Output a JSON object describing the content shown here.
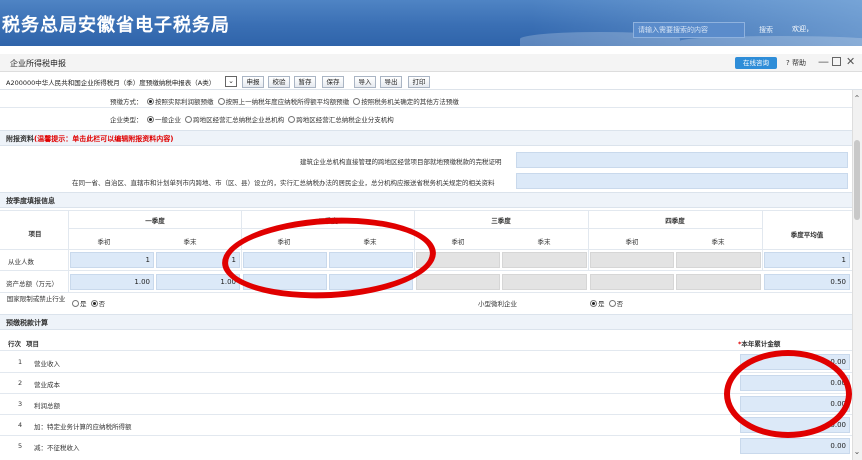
{
  "header": {
    "title": "税务总局安徽省电子税务局",
    "search_placeholder": "请输入需要搜索的内容",
    "search_label": "搜索",
    "welcome_text": "欢迎，"
  },
  "panel": {
    "title": "企业所得税申报",
    "online_help_label": "在线咨询",
    "help_label": "? 帮助",
    "minimize_label": "—",
    "close_label": "✕"
  },
  "toolbar": {
    "form_select_value": "A200000中华人民共和国企业所得税月（季）度预缴纳税申报表（A类）",
    "buttons": [
      "申报",
      "校验",
      "暂存",
      "保存",
      "导入",
      "导出",
      "打印"
    ]
  },
  "form": {
    "prepay_method_label": "预缴方式：",
    "prepay_options": [
      "按照实际利润额预缴",
      "按照上一纳税年度应纳税所得额平均额预缴",
      "按照税务机关确定的其他方法预缴"
    ],
    "enterprise_type_label": "企业类型：",
    "enterprise_options": [
      "一般企业",
      "跨地区经营汇总纳税企业总机构",
      "跨地区经营汇总纳税企业分支机构"
    ],
    "attach_title": "附报资料",
    "attach_hint": "(温馨提示：单击此栏可以编辑附报资料内容)",
    "attach_row1": "建筑企业总机构直接管理的跨地区经营项目部就地预缴税款的完税证明",
    "attach_row2": "在同一省、自治区、直辖市和计划单列市内跨地、市（区、县）设立的，实行汇总纳税办法的居民企业，总分机构应报送省税务机关规定的相关资料",
    "quarterly_title": "按季度填报信息",
    "item_header": "项目",
    "quarters": [
      "一季度",
      "二季度",
      "三季度",
      "四季度"
    ],
    "sub_headers": [
      "季初",
      "季末"
    ],
    "avg_header": "季度平均值",
    "employees_label": "从业人数",
    "employees_values": [
      "1",
      "1",
      "",
      "",
      "",
      "",
      "",
      ""
    ],
    "employees_avg": "1",
    "assets_label": "资产总额（万元）",
    "assets_values": [
      "1.00",
      "1.00",
      "",
      "",
      "",
      "",
      "",
      ""
    ],
    "assets_avg": "0.50",
    "restricted_label": "国家限制或禁止行业",
    "yes_label": "是",
    "no_label": "否",
    "small_label": "小型微利企业",
    "calc_title": "预缴税款计算",
    "row_no_header": "行次",
    "calc_item_header": "项目",
    "ytd_header": "本年累计金额",
    "ytd_star": "*",
    "rows": [
      {
        "no": "1",
        "label": "营业收入",
        "value": "0.00"
      },
      {
        "no": "2",
        "label": "营业成本",
        "value": "0.00"
      },
      {
        "no": "3",
        "label": "利润总额",
        "value": "0.00"
      },
      {
        "no": "4",
        "label": "加：特定业务计算的应纳税所得额",
        "value": "0.00"
      },
      {
        "no": "5",
        "label": "减：不征税收入",
        "value": "0.00"
      }
    ]
  },
  "colors": {
    "accent": "#2e8dd8",
    "banner": "#3a6fb4",
    "input_cell": "#dce9f8",
    "annotation": "#e00000"
  }
}
